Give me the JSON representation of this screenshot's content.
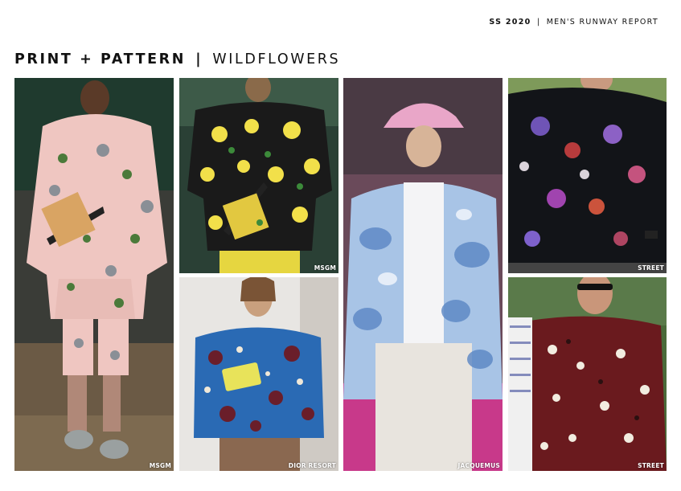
{
  "header": {
    "season": "SS 2020",
    "separator": "|",
    "report": "MEN'S RUNWAY REPORT"
  },
  "title": {
    "category": "PRINT + PATTERN",
    "separator": "|",
    "theme": "WILDFLOWERS"
  },
  "photos": [
    {
      "caption": "MSGM"
    },
    {
      "caption": "MSGM"
    },
    {
      "caption": "DIOR RESORT"
    },
    {
      "caption": "JACQUEMUS"
    },
    {
      "caption": "STREET"
    },
    {
      "caption": "STREET"
    }
  ]
}
